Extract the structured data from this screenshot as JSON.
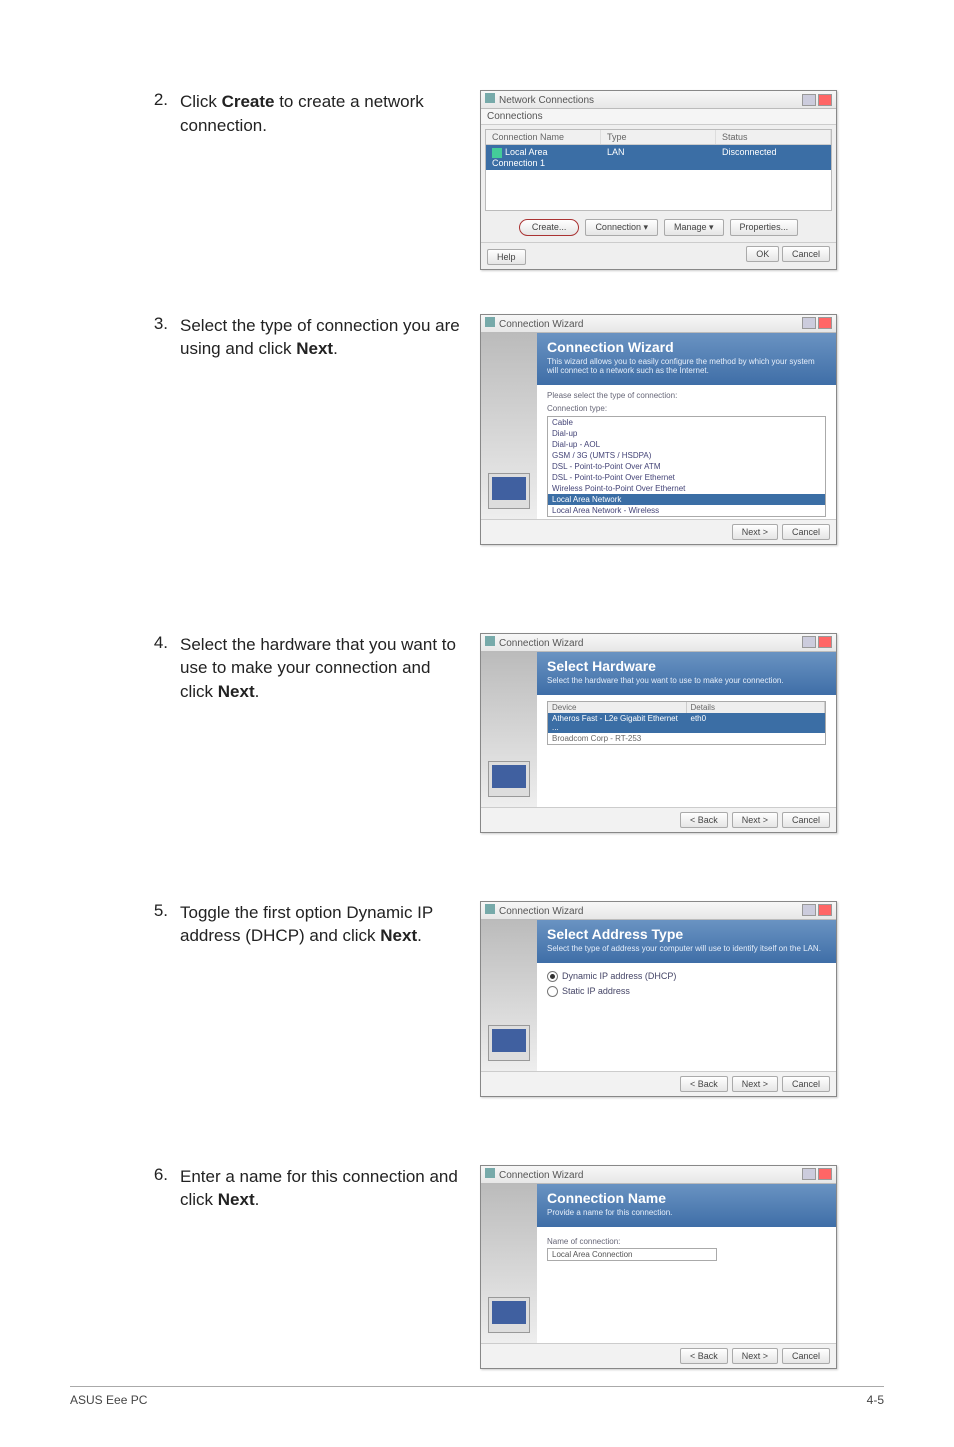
{
  "steps": {
    "s2": {
      "num": "2.",
      "a": "Click ",
      "bold": "Create",
      "b": " to create a network connection."
    },
    "s3": {
      "num": "3.",
      "a": "Select the type of connection you are using and click ",
      "bold": "Next",
      "b": "."
    },
    "s4": {
      "num": "4.",
      "a": "Select the hardware that you want to use to make your connection and click ",
      "bold": "Next",
      "b": "."
    },
    "s5": {
      "num": "5.",
      "a": "Toggle the first option Dynamic IP address (DHCP) and click ",
      "bold": "Next",
      "b": "."
    },
    "s6": {
      "num": "6.",
      "a": "Enter a name for this connection and click ",
      "bold": "Next",
      "b": "."
    }
  },
  "window_netconn": {
    "title": "Network Connections",
    "menu": "Connections",
    "col_name": "Connection Name",
    "col_type": "Type",
    "col_status": "Status",
    "row_name": "Local Area Connection 1",
    "row_type": "LAN",
    "row_status": "Disconnected",
    "btn_create": "Create...",
    "btn_conn": "Connection ▾",
    "btn_manage": "Manage ▾",
    "btn_props": "Properties...",
    "btn_help": "Help",
    "btn_ok": "OK",
    "btn_cancel": "Cancel"
  },
  "wizard_common": {
    "title": "Connection Wizard",
    "btn_back": "< Back",
    "btn_next": "Next >",
    "btn_cancel": "Cancel"
  },
  "wizard_type": {
    "heading": "Connection Wizard",
    "desc": "This wizard allows you to easily configure the method by which your system will connect to a network such as the Internet.",
    "prompt": "Please select the type of connection:",
    "label": "Connection type:",
    "items": [
      "Cable",
      "Dial-up",
      "Dial-up - AOL",
      "GSM / 3G (UMTS / HSDPA)",
      "DSL - Point-to-Point Over ATM",
      "DSL - Point-to-Point Over Ethernet",
      "Wireless Point-to-Point Over Ethernet",
      "Local Area Network",
      "Local Area Network - Wireless"
    ],
    "selected_index": 7
  },
  "wizard_hw": {
    "heading": "Select Hardware",
    "desc": "Select the hardware that you want to use to make your connection.",
    "col_device": "Device",
    "col_details": "Details",
    "row1_device": "Atheros Fast - L2e Gigabit Ethernet ...",
    "row1_details": "eth0",
    "row2_device": "Broadcom Corp - RT-253",
    "row2_details": ""
  },
  "wizard_addr": {
    "heading": "Select Address Type",
    "desc": "Select the type of address your computer will use to identify itself on the LAN.",
    "opt1": "Dynamic IP address (DHCP)",
    "opt2": "Static IP address"
  },
  "wizard_name": {
    "heading": "Connection Name",
    "desc": "Provide a name for this connection.",
    "label": "Name of connection:",
    "value": "Local Area Connection"
  },
  "footer": {
    "left": "ASUS Eee PC",
    "right": "4-5"
  }
}
